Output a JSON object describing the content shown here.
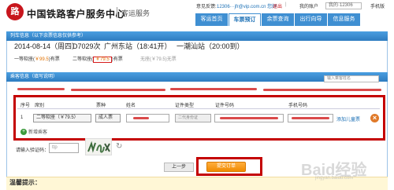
{
  "header": {
    "logo_glyph": "路",
    "site_title": "中国铁路客户服务中心",
    "site_subtitle": "客运服务",
    "welcome": "意见反馈:",
    "user_email": "12306···jfr@vip.com.cn  您好",
    "exit_link": "退出",
    "separator": "|",
    "help": "我的账户",
    "search_placeholder": "我的·12306",
    "mobile": "手机版"
  },
  "nav": {
    "items": [
      "客运首页",
      "车票预订",
      "余票查询",
      "出行向导",
      "信息服务"
    ],
    "active_index": 1
  },
  "train_panel": {
    "title": "列车信息（以下余票信息仅供参考）",
    "date": "2014-08-14（周四）",
    "train_no": "D7029次",
    "from": "广州东站（18:41开）",
    "to": "一潮汕站（20:00到）",
    "seats": [
      {
        "name": "一等软座",
        "price": "￥99.5",
        "status": "有票"
      },
      {
        "name": "二等软座",
        "price": "￥79.5",
        "status": "有票"
      },
      {
        "name": "无座",
        "price": "￥79.5",
        "status": "无票"
      }
    ]
  },
  "passenger_panel": {
    "title": "乘客信息（填写说明）",
    "search_placeholder": "输入乘客姓名"
  },
  "table": {
    "headers": [
      "序号",
      "席别",
      "票种",
      "姓名",
      "证件类型",
      "证件号码",
      "手机号码"
    ],
    "row": {
      "index": "1",
      "seat": "二等软座（￥79.5）",
      "ticket_type": "成人票",
      "id_type": "二代身份证"
    },
    "add_child": "添加儿童票",
    "delete_glyph": "×",
    "add_passenger": "新增乘客"
  },
  "captcha": {
    "label": "请输入验证码：",
    "placeholder": "ttp",
    "refresh_glyph": "↻"
  },
  "buttons": {
    "prev": "上一步",
    "submit": "提交订单"
  },
  "tips": {
    "title": "温馨提示："
  },
  "watermark": {
    "text": "Baid经验",
    "sub": "jingyan.baidu.com"
  },
  "colors": {
    "brand_red": "#c8161d",
    "nav_blue": "#3f8fd2",
    "highlight_red": "#c40000",
    "submit_orange": "#f08a00"
  }
}
